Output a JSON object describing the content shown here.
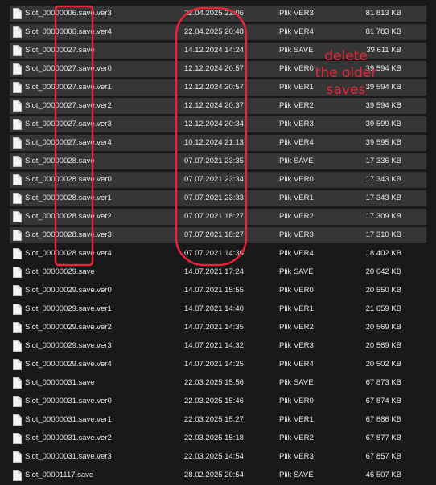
{
  "colors": {
    "background": "#191919",
    "selected_row": "#363636",
    "text": "#e6e6e6",
    "annotation_red": "#e8233a"
  },
  "annotation": {
    "lines": [
      "delete",
      "the older",
      "saves"
    ]
  },
  "files": [
    {
      "name": "Slot_00000006.save.ver3",
      "date": "22.04.2025 22:06",
      "type": "Plik VER3",
      "size": "81 813 KB",
      "selected": true,
      "icon": "file-icon"
    },
    {
      "name": "Slot_00000006.save.ver4",
      "date": "22.04.2025 20:48",
      "type": "Plik VER4",
      "size": "81 783 KB",
      "selected": true,
      "icon": "file-icon"
    },
    {
      "name": "Slot_00000027.save",
      "date": "14.12.2024 14:24",
      "type": "Plik SAVE",
      "size": "39 611 KB",
      "selected": true,
      "icon": "file-icon"
    },
    {
      "name": "Slot_00000027.save.ver0",
      "date": "12.12.2024 20:57",
      "type": "Plik VER0",
      "size": "39 594 KB",
      "selected": true,
      "icon": "file-icon"
    },
    {
      "name": "Slot_00000027.save.ver1",
      "date": "12.12.2024 20:57",
      "type": "Plik VER1",
      "size": "39 594 KB",
      "selected": true,
      "icon": "file-icon"
    },
    {
      "name": "Slot_00000027.save.ver2",
      "date": "12.12.2024 20:37",
      "type": "Plik VER2",
      "size": "39 594 KB",
      "selected": true,
      "icon": "file-icon"
    },
    {
      "name": "Slot_00000027.save.ver3",
      "date": "12.12.2024 20:34",
      "type": "Plik VER3",
      "size": "39 599 KB",
      "selected": true,
      "icon": "file-icon"
    },
    {
      "name": "Slot_00000027.save.ver4",
      "date": "10.12.2024 21:13",
      "type": "Plik VER4",
      "size": "39 595 KB",
      "selected": true,
      "icon": "file-icon"
    },
    {
      "name": "Slot_00000028.save",
      "date": "07.07.2021 23:35",
      "type": "Plik SAVE",
      "size": "17 336 KB",
      "selected": true,
      "icon": "file-icon"
    },
    {
      "name": "Slot_00000028.save.ver0",
      "date": "07.07.2021 23:34",
      "type": "Plik VER0",
      "size": "17 343 KB",
      "selected": true,
      "icon": "file-icon"
    },
    {
      "name": "Slot_00000028.save.ver1",
      "date": "07.07.2021 23:33",
      "type": "Plik VER1",
      "size": "17 343 KB",
      "selected": true,
      "icon": "file-icon"
    },
    {
      "name": "Slot_00000028.save.ver2",
      "date": "07.07.2021 18:27",
      "type": "Plik VER2",
      "size": "17 309 KB",
      "selected": true,
      "icon": "file-icon"
    },
    {
      "name": "Slot_00000028.save.ver3",
      "date": "07.07.2021 18:27",
      "type": "Plik VER3",
      "size": "17 310 KB",
      "selected": true,
      "icon": "file-icon"
    },
    {
      "name": "Slot_00000028.save.ver4",
      "date": "07.07.2021 14:36",
      "type": "Plik VER4",
      "size": "18 402 KB",
      "selected": false,
      "icon": "file-icon"
    },
    {
      "name": "Slot_00000029.save",
      "date": "14.07.2021 17:24",
      "type": "Plik SAVE",
      "size": "20 642 KB",
      "selected": false,
      "icon": "file-icon"
    },
    {
      "name": "Slot_00000029.save.ver0",
      "date": "14.07.2021 15:55",
      "type": "Plik VER0",
      "size": "20 550 KB",
      "selected": false,
      "icon": "file-icon"
    },
    {
      "name": "Slot_00000029.save.ver1",
      "date": "14.07.2021 14:40",
      "type": "Plik VER1",
      "size": "21 659 KB",
      "selected": false,
      "icon": "file-icon"
    },
    {
      "name": "Slot_00000029.save.ver2",
      "date": "14.07.2021 14:35",
      "type": "Plik VER2",
      "size": "20 569 KB",
      "selected": false,
      "icon": "file-icon"
    },
    {
      "name": "Slot_00000029.save.ver3",
      "date": "14.07.2021 14:32",
      "type": "Plik VER3",
      "size": "20 569 KB",
      "selected": false,
      "icon": "file-icon"
    },
    {
      "name": "Slot_00000029.save.ver4",
      "date": "14.07.2021 14:25",
      "type": "Plik VER4",
      "size": "20 502 KB",
      "selected": false,
      "icon": "file-icon"
    },
    {
      "name": "Slot_00000031.save",
      "date": "22.03.2025 15:56",
      "type": "Plik SAVE",
      "size": "67 873 KB",
      "selected": false,
      "icon": "file-icon"
    },
    {
      "name": "Slot_00000031.save.ver0",
      "date": "22.03.2025 15:46",
      "type": "Plik VER0",
      "size": "67 874 KB",
      "selected": false,
      "icon": "file-icon"
    },
    {
      "name": "Slot_00000031.save.ver1",
      "date": "22.03.2025 15:27",
      "type": "Plik VER1",
      "size": "67 886 KB",
      "selected": false,
      "icon": "file-icon"
    },
    {
      "name": "Slot_00000031.save.ver2",
      "date": "22.03.2025 15:18",
      "type": "Plik VER2",
      "size": "67 877 KB",
      "selected": false,
      "icon": "file-icon"
    },
    {
      "name": "Slot_00000031.save.ver3",
      "date": "22.03.2025 14:54",
      "type": "Plik VER3",
      "size": "67 857 KB",
      "selected": false,
      "icon": "file-icon"
    },
    {
      "name": "Slot_00001117.save",
      "date": "28.02.2025 20:54",
      "type": "Plik SAVE",
      "size": "46 507 KB",
      "selected": false,
      "icon": "file-icon"
    }
  ]
}
